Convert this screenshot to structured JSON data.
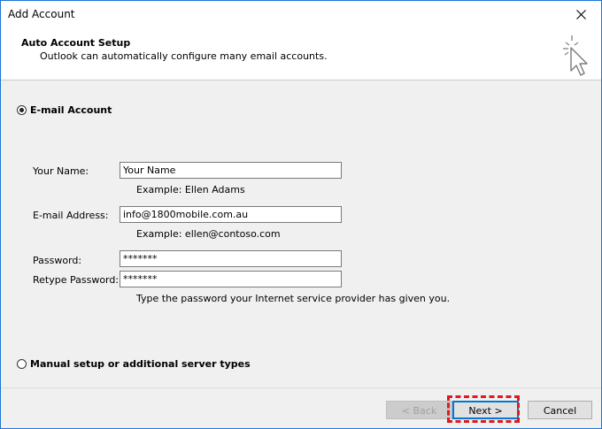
{
  "window": {
    "title": "Add Account"
  },
  "header": {
    "title": "Auto Account Setup",
    "subtitle": "Outlook can automatically configure many email accounts."
  },
  "options": {
    "email_account": {
      "label": "E-mail Account",
      "selected": true
    },
    "manual_setup": {
      "label": "Manual setup or additional server types",
      "selected": false
    }
  },
  "form": {
    "your_name": {
      "label": "Your Name:",
      "value": "Your Name",
      "hint": "Example: Ellen Adams"
    },
    "email": {
      "label": "E-mail Address:",
      "value": "info@1800mobile.com.au",
      "hint": "Example: ellen@contoso.com"
    },
    "password": {
      "label": "Password:",
      "value": "*******"
    },
    "retype_password": {
      "label": "Retype Password:",
      "value": "*******"
    },
    "password_hint": "Type the password your Internet service provider has given you."
  },
  "buttons": {
    "back": "< Back",
    "next": "Next >",
    "cancel": "Cancel"
  },
  "colors": {
    "accent": "#0078d7",
    "highlight": "#e0191e"
  },
  "icons": {
    "close": "close-icon",
    "wizard": "cursor-sparkle-icon"
  }
}
